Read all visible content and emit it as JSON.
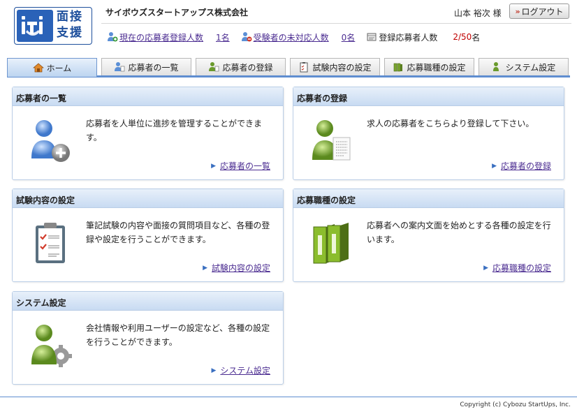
{
  "logo": {
    "text_line1": "面接",
    "text_line2": "支援"
  },
  "company_name": "サイボウズスタートアップス株式会社",
  "user": {
    "name": "山本 裕次 様",
    "logout_label": "ログアウト",
    "logout_prefix": "»"
  },
  "stats": {
    "current_applicants": {
      "label": "現在の応募者登録人数",
      "value": "1名"
    },
    "unhandled": {
      "label": "受験者の未対応人数",
      "value": "0名"
    },
    "registered": {
      "label": "登録応募者人数",
      "value": "2/50",
      "unit": "名"
    }
  },
  "tabs": [
    {
      "label": "ホーム",
      "icon": "home-icon"
    },
    {
      "label": "応募者の一覧",
      "icon": "applicant-list-icon"
    },
    {
      "label": "応募者の登録",
      "icon": "applicant-register-icon"
    },
    {
      "label": "試験内容の設定",
      "icon": "exam-settings-icon"
    },
    {
      "label": "応募職種の設定",
      "icon": "job-type-icon"
    },
    {
      "label": "システム設定",
      "icon": "system-settings-icon"
    }
  ],
  "cards": {
    "applicant_list": {
      "title": "応募者の一覧",
      "desc": "応募者を人単位に進捗を管理することができます。",
      "link": "応募者の一覧"
    },
    "applicant_register": {
      "title": "応募者の登録",
      "desc": "求人の応募者をこちらより登録して下さい。",
      "link": "応募者の登録"
    },
    "exam_settings": {
      "title": "試験内容の設定",
      "desc": "筆記試験の内容や面接の質問項目など、各種の登録や設定を行うことができます。",
      "link": "試験内容の設定"
    },
    "job_type": {
      "title": "応募職種の設定",
      "desc": "応募者への案内文面を始めとする各種の設定を行います。",
      "link": "応募職種の設定"
    },
    "system_settings": {
      "title": "システム設定",
      "desc": "会社情報や利用ユーザーの設定など、各種の設定を行うことができます。",
      "link": "システム設定"
    }
  },
  "footer": {
    "copyright": "Copyright (c) Cybozu StartUps, Inc."
  },
  "colors": {
    "accent": "#5f8ed0",
    "link": "#4b2c91",
    "alert": "#c00000",
    "brand": "#2a62b8"
  }
}
